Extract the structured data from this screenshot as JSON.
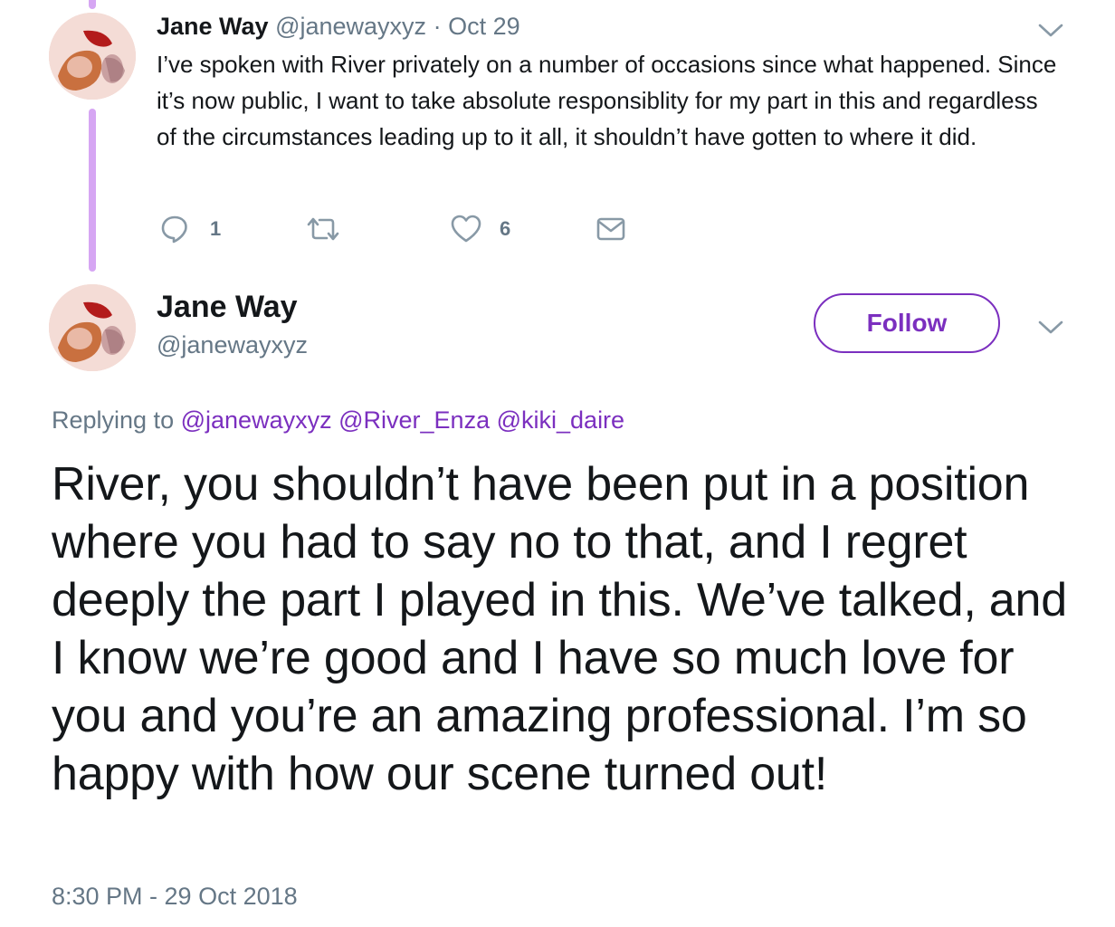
{
  "parent_tweet": {
    "author_name": "Jane Way",
    "author_handle": "@janewayxyz",
    "separator": "·",
    "date": "Oct 29",
    "text": "I’ve spoken with River privately on a number of occasions since what happened. Since it’s now public, I want to take absolute responsiblity for my part in this and regardless of the circumstances leading up to it all, it shouldn’t have gotten to where it did.",
    "reply_count": "1",
    "like_count": "6"
  },
  "main_tweet": {
    "author_name": "Jane Way",
    "author_handle": "@janewayxyz",
    "follow_label": "Follow",
    "replying_prefix": "Replying to",
    "mentions": [
      "@janewayxyz",
      "@River_Enza",
      "@kiki_daire"
    ],
    "text": "River, you shouldn’t have been put in a position where you had to say no to that, and I regret deeply the part I played in this. We’ve talked, and I know we’re good and I have so much love for you and you’re an amazing professional. I’m so happy with how our scene turned out!",
    "timestamp": "8:30 PM - 29 Oct 2018"
  },
  "colors": {
    "accent": "#7b2fbf",
    "thread_line": "#d6a6f3",
    "muted_text": "#657786",
    "text": "#14171a"
  },
  "icons": [
    "chevron-down-icon",
    "reply-icon",
    "retweet-icon",
    "like-icon",
    "direct-message-icon"
  ]
}
